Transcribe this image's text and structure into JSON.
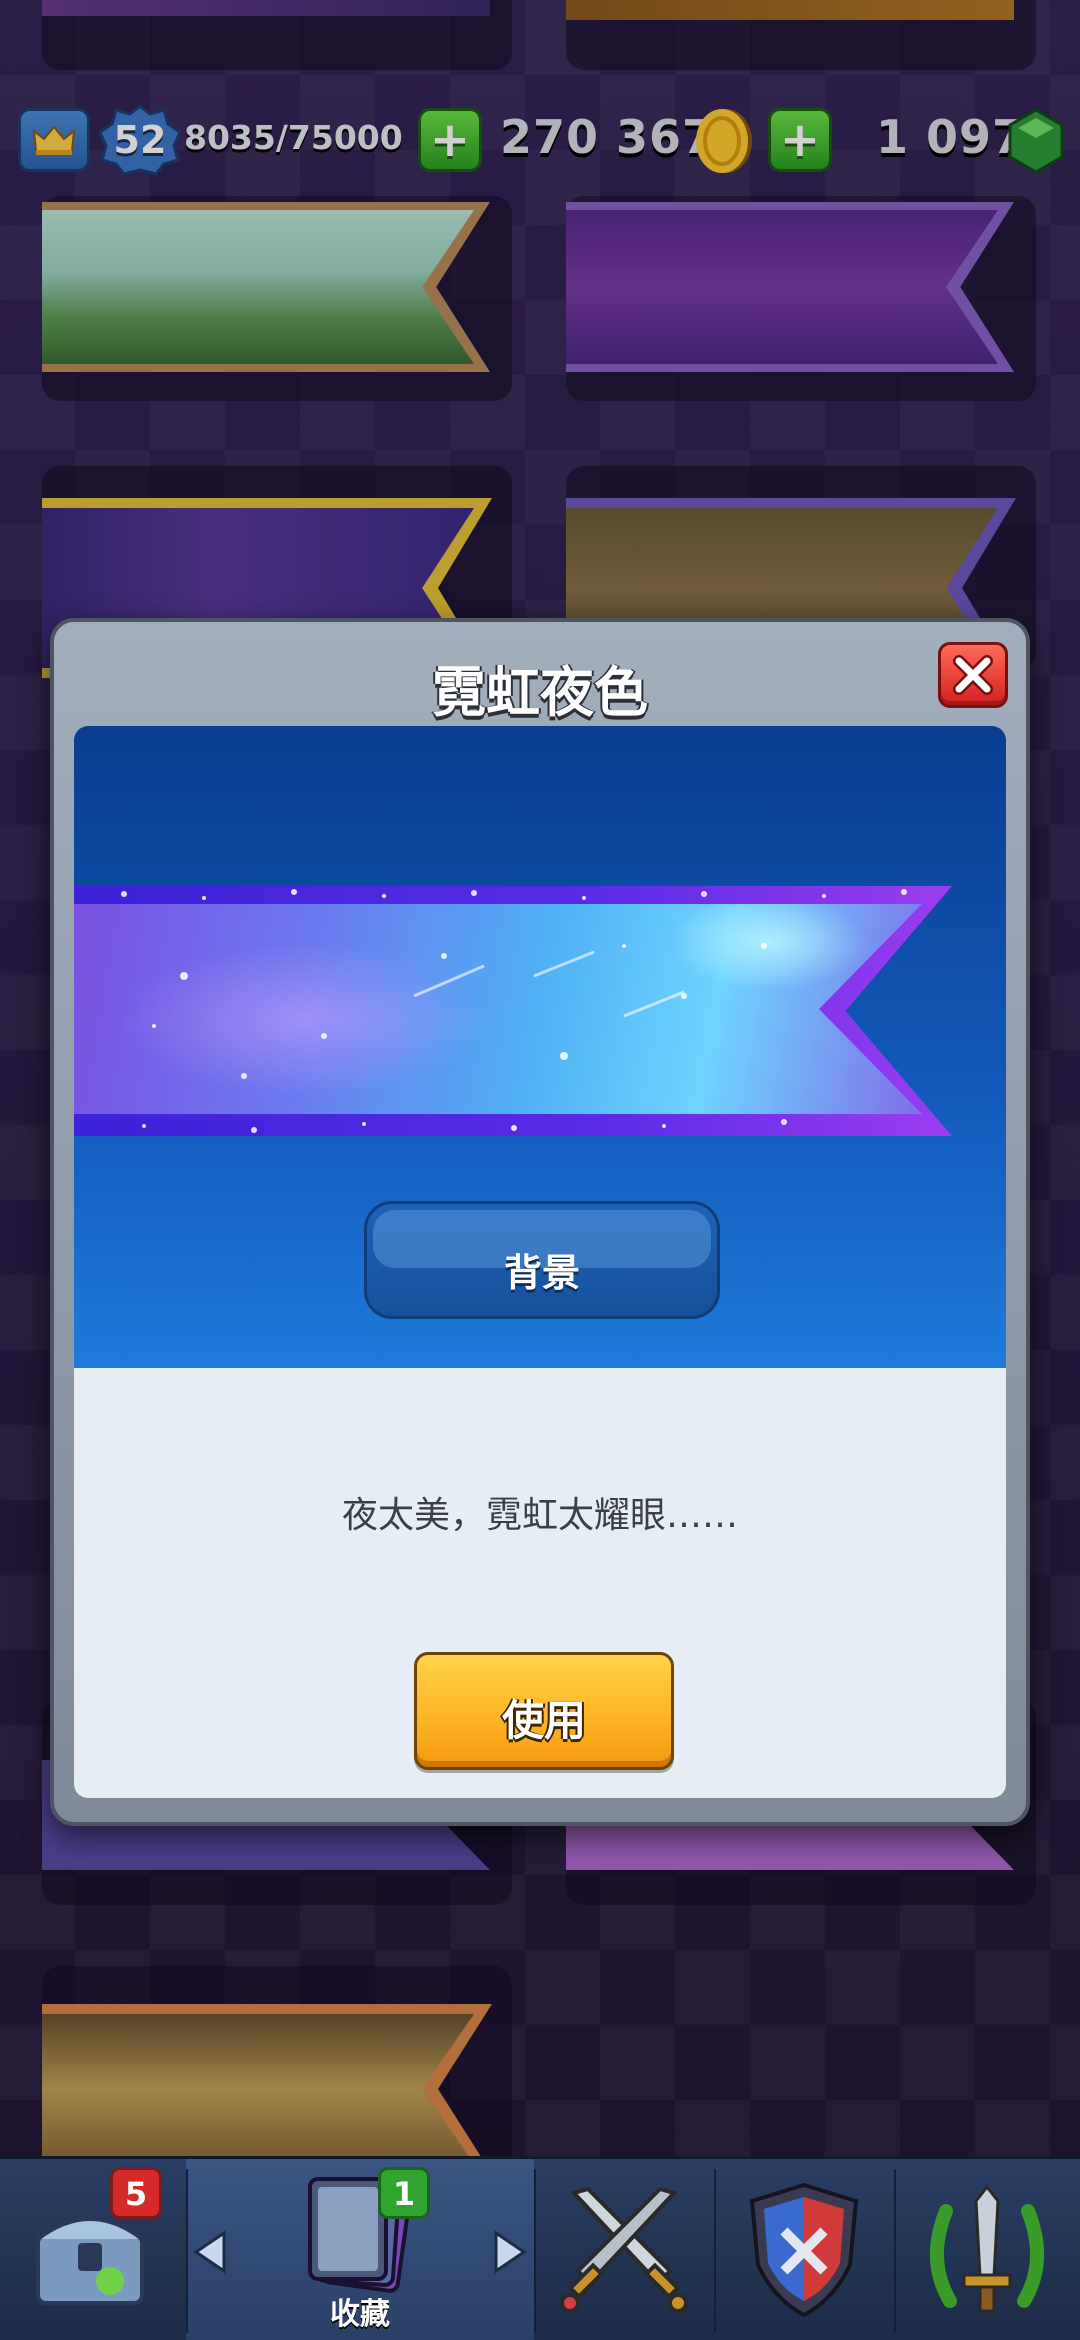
{
  "top_bar": {
    "level": "52",
    "xp": "8035/75000",
    "gold": "270 367",
    "gems": "1 097"
  },
  "modal": {
    "title": "霓虹夜色",
    "item_type": "背景",
    "description": "夜太美，霓虹太耀眼……",
    "use_button": "使用"
  },
  "bottom_nav": {
    "chest_badge": "5",
    "collection_badge": "1",
    "collection_label": "收藏",
    "active_tab": "collection"
  },
  "colors": {
    "modal_frame": "#8d98a7",
    "preview_blue": "#1258b8",
    "use_button": "#ffb526",
    "close_button": "#d32020"
  }
}
